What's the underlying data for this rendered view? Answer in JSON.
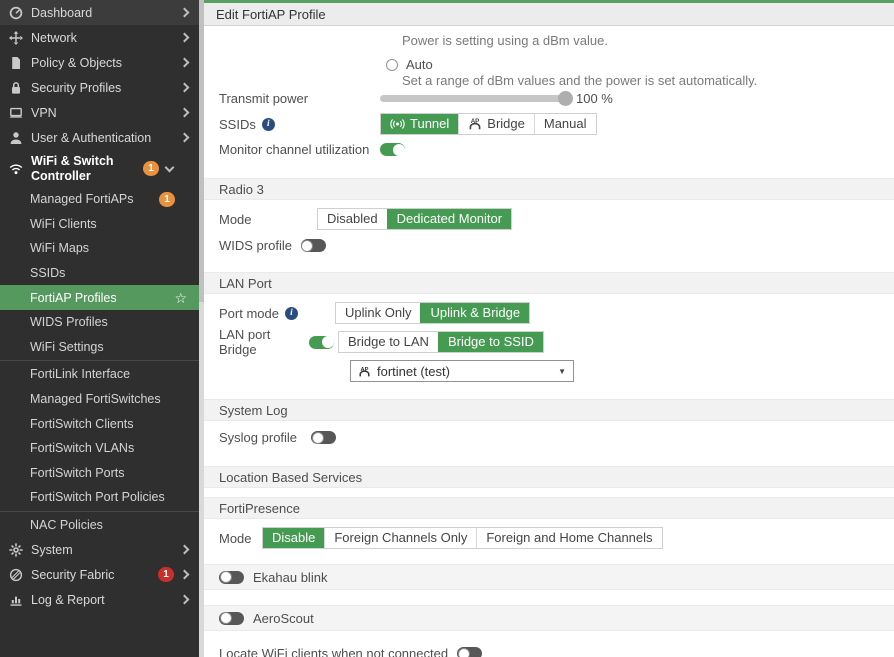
{
  "header": {
    "title": "Edit FortiAP Profile"
  },
  "icons": {
    "info": "i",
    "star": "☆",
    "caret": "▼"
  },
  "colors": {
    "accent_green": "#469b52",
    "sidebar_active_green": "#56995e",
    "top_strip_green": "#57a05f",
    "sidebar_bg": "#2f2f2f",
    "badge_orange": "#e8923e",
    "badge_red": "#c9302c",
    "info_blue": "#2a4d80"
  },
  "sidebar": {
    "items": [
      {
        "label": "Dashboard",
        "icon": "gauge-icon"
      },
      {
        "label": "Network",
        "icon": "move-arrows-icon"
      },
      {
        "label": "Policy & Objects",
        "icon": "document-icon"
      },
      {
        "label": "Security Profiles",
        "icon": "lock-icon"
      },
      {
        "label": "VPN",
        "icon": "laptop-icon"
      },
      {
        "label": "User & Authentication",
        "icon": "user-icon"
      },
      {
        "label": "WiFi & Switch Controller",
        "icon": "wifi-icon",
        "badge": "1"
      }
    ],
    "subitems": [
      {
        "label": "Managed FortiAPs",
        "badge": "1"
      },
      {
        "label": "WiFi Clients"
      },
      {
        "label": "WiFi Maps"
      },
      {
        "label": "SSIDs"
      },
      {
        "label": "FortiAP Profiles",
        "active": true
      },
      {
        "label": "WIDS Profiles"
      },
      {
        "label": "WiFi Settings"
      },
      {
        "label": "FortiLink Interface"
      },
      {
        "label": "Managed FortiSwitches"
      },
      {
        "label": "FortiSwitch Clients"
      },
      {
        "label": "FortiSwitch VLANs"
      },
      {
        "label": "FortiSwitch Ports"
      },
      {
        "label": "FortiSwitch Port Policies"
      },
      {
        "label": "NAC Policies"
      }
    ],
    "bottom_items": [
      {
        "label": "System",
        "icon": "gear-icon"
      },
      {
        "label": "Security Fabric",
        "icon": "fabric-icon",
        "badge": "1"
      },
      {
        "label": "Log & Report",
        "icon": "bar-chart-icon"
      }
    ]
  },
  "form": {
    "power_manual_desc": "Power is setting using a dBm value.",
    "auto_radio": {
      "label": "Auto",
      "desc": "Set a range of dBm values and the power is set automatically."
    },
    "transmit_power": {
      "label": "Transmit power",
      "value": "100 %",
      "percent": 100
    },
    "ssids": {
      "label": "SSIDs",
      "options": [
        "Tunnel",
        "Bridge",
        "Manual"
      ],
      "selected": "Tunnel"
    },
    "monitor_channel": {
      "label": "Monitor channel utilization",
      "enabled": true
    },
    "radio3": {
      "title": "Radio 3",
      "mode_label": "Mode",
      "mode_options": [
        "Disabled",
        "Dedicated Monitor"
      ],
      "mode_selected": "Dedicated Monitor",
      "wids_label": "WIDS profile",
      "wids_enabled": false
    },
    "lan_port": {
      "title": "LAN Port",
      "port_mode_label": "Port mode",
      "port_mode_options": [
        "Uplink Only",
        "Uplink & Bridge"
      ],
      "port_mode_selected": "Uplink & Bridge",
      "bridge_label": "LAN port Bridge",
      "bridge_enabled": true,
      "bridge_options": [
        "Bridge to LAN",
        "Bridge to SSID"
      ],
      "bridge_selected": "Bridge to SSID",
      "ssid_selected": "fortinet (test)"
    },
    "system_log": {
      "title": "System Log",
      "syslog_label": "Syslog profile",
      "syslog_enabled": false
    },
    "lbs": {
      "title": "Location Based Services",
      "fortipresence_title": "FortiPresence",
      "mode_label": "Mode",
      "mode_options": [
        "Disable",
        "Foreign Channels Only",
        "Foreign and Home Channels"
      ],
      "mode_selected": "Disable",
      "ekahau_label": "Ekahau blink",
      "ekahau_enabled": false,
      "aeroscout_label": "AeroScout",
      "aeroscout_enabled": false,
      "locate_label": "Locate WiFi clients when not connected",
      "locate_enabled": false
    }
  }
}
